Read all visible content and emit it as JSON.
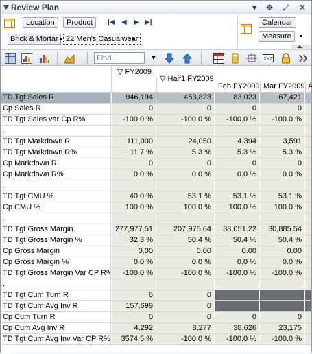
{
  "title": "Review Plan",
  "pivot": {
    "location_label": "Location",
    "product_label": "Product",
    "calendar_label": "Calendar",
    "measure_label": "Measure",
    "crumb1": "Brick & Mortar",
    "crumb2": "22 Men's Casualwear"
  },
  "toolbar": {
    "find_placeholder": "Find..."
  },
  "columns": {
    "fy": "▽ FY2009",
    "half": "▽ Half1 FY2009",
    "feb": "Feb FY2009",
    "mar": "Mar FY2009",
    "apr": "A"
  },
  "rows": [
    {
      "label": "TD Tgt Sales R",
      "values": [
        "946,194",
        "453,823",
        "83,023",
        "67,421",
        ""
      ],
      "selected": true
    },
    {
      "label": "Cp Sales R",
      "values": [
        "0",
        "0",
        "0",
        "0",
        ""
      ]
    },
    {
      "label": "TD Tgt Sales var Cp R%",
      "values": [
        "-100.0 %",
        "-100.0 %",
        "-100.0 %",
        "-100.0 %",
        ""
      ]
    },
    {
      "label": ".",
      "values": [
        "",
        "",
        "",
        "",
        ""
      ]
    },
    {
      "label": "TD Tgt Markdown R",
      "values": [
        "111,000",
        "24,050",
        "4,394",
        "3,591",
        ""
      ]
    },
    {
      "label": "TD Tgt Markdown R%",
      "values": [
        "11.7 %",
        "5.3 %",
        "5.3 %",
        "5.3 %",
        ""
      ]
    },
    {
      "label": "Cp Markdown R",
      "values": [
        "0",
        "0",
        "0",
        "0",
        ""
      ]
    },
    {
      "label": "Cp Markdown R%",
      "values": [
        "0.0 %",
        "0.0 %",
        "0.0 %",
        "0.0 %",
        ""
      ]
    },
    {
      "label": ".",
      "values": [
        "",
        "",
        "",
        "",
        ""
      ]
    },
    {
      "label": "TD Tgt CMU %",
      "values": [
        "40.0 %",
        "53.1 %",
        "53.1 %",
        "53.1 %",
        ""
      ]
    },
    {
      "label": "Cp CMU %",
      "values": [
        "100.0 %",
        "100.0 %",
        "100.0 %",
        "100.0 %",
        ""
      ]
    },
    {
      "label": ".",
      "values": [
        "",
        "",
        "",
        "",
        ""
      ]
    },
    {
      "label": "TD Tgt Gross Margin",
      "values": [
        "277,977.51",
        "207,975.64",
        "38,051.22",
        "30,885.54",
        ""
      ]
    },
    {
      "label": "TD Tgt Gross Margin %",
      "values": [
        "32.3 %",
        "50.4 %",
        "50.4 %",
        "50.4 %",
        ""
      ]
    },
    {
      "label": "Cp Gross Margin",
      "values": [
        "0.00",
        "0.00",
        "0.00",
        "0.00",
        ""
      ]
    },
    {
      "label": "Cp Gross Margin %",
      "values": [
        "0.0 %",
        "0.0 %",
        "0.0 %",
        "0.0 %",
        ""
      ]
    },
    {
      "label": "TD Tgt Gross Margin Var CP R%",
      "values": [
        "-100.0 %",
        "-100.0 %",
        "-100.0 %",
        "-100.0 %",
        ""
      ]
    },
    {
      "label": ".",
      "values": [
        "",
        "",
        "",
        "",
        ""
      ]
    },
    {
      "label": "TD Tgt Cum Turn R",
      "values": [
        "6",
        "0",
        "",
        "",
        ""
      ],
      "dark_from": 2
    },
    {
      "label": "TD Tgt Cum Avg Inv R",
      "values": [
        "157,699",
        "0",
        "",
        "",
        ""
      ],
      "dark_from": 2
    },
    {
      "label": "Cp Cum Turn R",
      "values": [
        "0",
        "0",
        "0",
        "0",
        ""
      ]
    },
    {
      "label": "Cp Cum Avg Inv R",
      "values": [
        "4,292",
        "8,277",
        "38,626",
        "23,175",
        ""
      ]
    },
    {
      "label": "TD Tgt Cum Avg Inv Var CP R%",
      "values": [
        "3574.5 %",
        "-100.0 %",
        "-100.0 %",
        "-100.0 %",
        ""
      ]
    }
  ]
}
